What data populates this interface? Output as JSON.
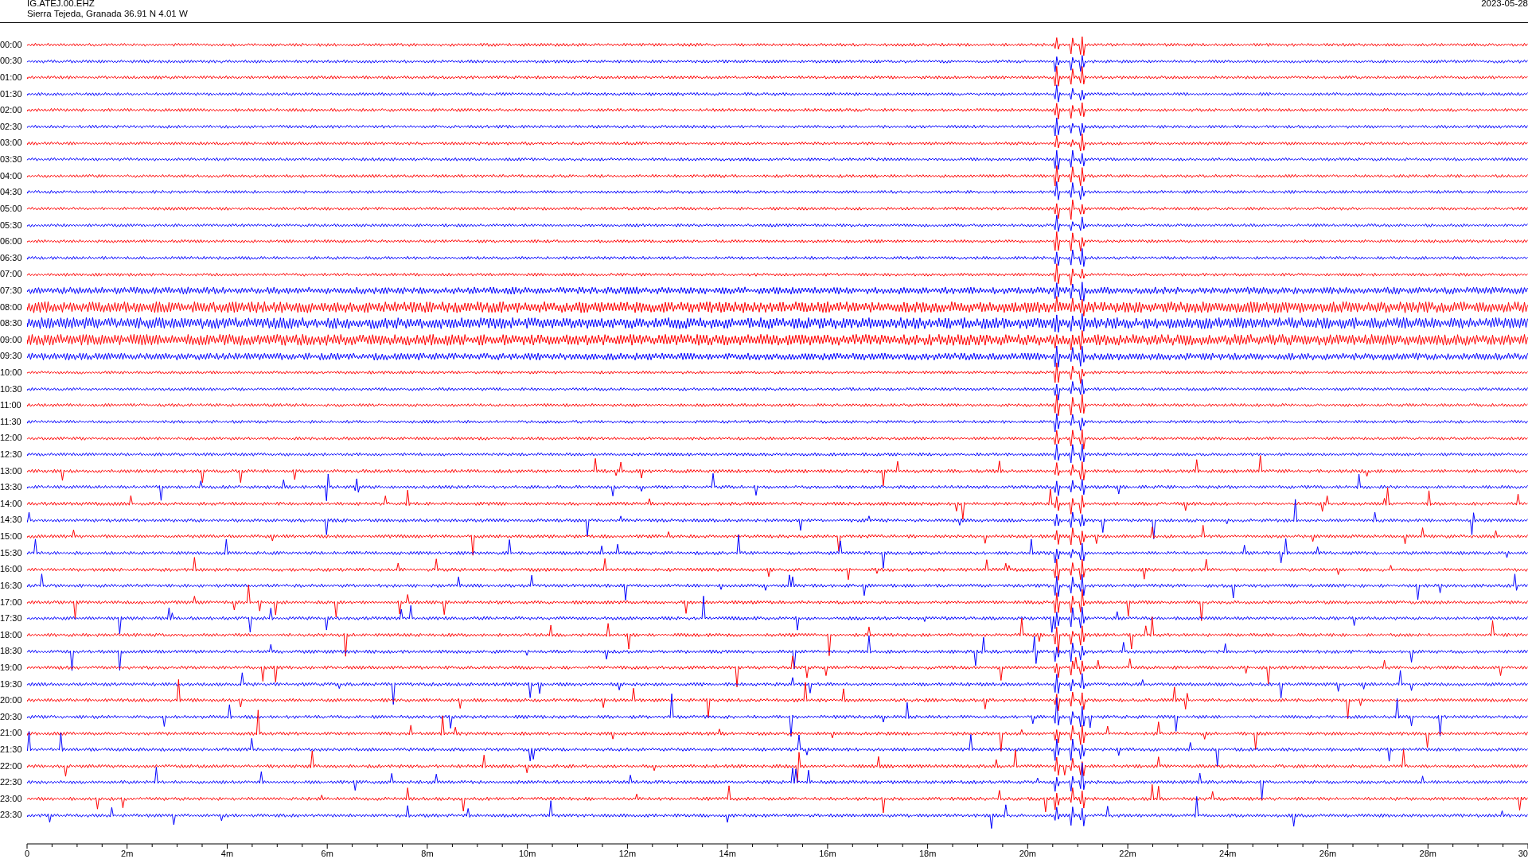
{
  "header": {
    "station": "IG.ATEJ.00.EHZ",
    "location": "Sierra Tejeda, Granada  36.91 N 4.01 W",
    "date": "2023-05-28"
  },
  "rows": [
    {
      "time": "00:00",
      "color": "#ff0000",
      "kind": "quiet"
    },
    {
      "time": "00:30",
      "color": "#0000ff",
      "kind": "quiet"
    },
    {
      "time": "01:00",
      "color": "#ff0000",
      "kind": "quiet"
    },
    {
      "time": "01:30",
      "color": "#0000ff",
      "kind": "quiet"
    },
    {
      "time": "02:00",
      "color": "#ff0000",
      "kind": "quiet"
    },
    {
      "time": "02:30",
      "color": "#0000ff",
      "kind": "quiet"
    },
    {
      "time": "03:00",
      "color": "#ff0000",
      "kind": "quiet"
    },
    {
      "time": "03:30",
      "color": "#0000ff",
      "kind": "quiet"
    },
    {
      "time": "04:00",
      "color": "#ff0000",
      "kind": "quiet"
    },
    {
      "time": "04:30",
      "color": "#0000ff",
      "kind": "quiet"
    },
    {
      "time": "05:00",
      "color": "#ff0000",
      "kind": "quiet"
    },
    {
      "time": "05:30",
      "color": "#0000ff",
      "kind": "quiet"
    },
    {
      "time": "06:00",
      "color": "#ff0000",
      "kind": "quiet"
    },
    {
      "time": "06:30",
      "color": "#0000ff",
      "kind": "quiet"
    },
    {
      "time": "07:00",
      "color": "#ff0000",
      "kind": "quiet"
    },
    {
      "time": "07:30",
      "color": "#0000ff",
      "kind": "noisy"
    },
    {
      "time": "08:00",
      "color": "#ff0000",
      "kind": "loud"
    },
    {
      "time": "08:30",
      "color": "#0000ff",
      "kind": "loud"
    },
    {
      "time": "09:00",
      "color": "#ff0000",
      "kind": "loud"
    },
    {
      "time": "09:30",
      "color": "#0000ff",
      "kind": "noisy"
    },
    {
      "time": "10:00",
      "color": "#ff0000",
      "kind": "quiet"
    },
    {
      "time": "10:30",
      "color": "#0000ff",
      "kind": "quiet"
    },
    {
      "time": "11:00",
      "color": "#ff0000",
      "kind": "quiet"
    },
    {
      "time": "11:30",
      "color": "#0000ff",
      "kind": "quiet"
    },
    {
      "time": "12:00",
      "color": "#ff0000",
      "kind": "quiet"
    },
    {
      "time": "12:30",
      "color": "#0000ff",
      "kind": "quiet"
    },
    {
      "time": "13:00",
      "color": "#ff0000",
      "kind": "spiky"
    },
    {
      "time": "13:30",
      "color": "#0000ff",
      "kind": "spiky"
    },
    {
      "time": "14:00",
      "color": "#ff0000",
      "kind": "spiky"
    },
    {
      "time": "14:30",
      "color": "#0000ff",
      "kind": "spiky"
    },
    {
      "time": "15:00",
      "color": "#ff0000",
      "kind": "spiky"
    },
    {
      "time": "15:30",
      "color": "#0000ff",
      "kind": "spiky"
    },
    {
      "time": "16:00",
      "color": "#ff0000",
      "kind": "spiky"
    },
    {
      "time": "16:30",
      "color": "#0000ff",
      "kind": "spiky"
    },
    {
      "time": "17:00",
      "color": "#ff0000",
      "kind": "spiky"
    },
    {
      "time": "17:30",
      "color": "#0000ff",
      "kind": "spiky"
    },
    {
      "time": "18:00",
      "color": "#ff0000",
      "kind": "spiky"
    },
    {
      "time": "18:30",
      "color": "#0000ff",
      "kind": "spiky"
    },
    {
      "time": "19:00",
      "color": "#ff0000",
      "kind": "spiky"
    },
    {
      "time": "19:30",
      "color": "#0000ff",
      "kind": "spiky"
    },
    {
      "time": "20:00",
      "color": "#ff0000",
      "kind": "spiky"
    },
    {
      "time": "20:30",
      "color": "#0000ff",
      "kind": "spiky"
    },
    {
      "time": "21:00",
      "color": "#ff0000",
      "kind": "spiky"
    },
    {
      "time": "21:30",
      "color": "#0000ff",
      "kind": "spiky"
    },
    {
      "time": "22:00",
      "color": "#ff0000",
      "kind": "spiky"
    },
    {
      "time": "22:30",
      "color": "#0000ff",
      "kind": "spiky"
    },
    {
      "time": "23:00",
      "color": "#ff0000",
      "kind": "spiky"
    },
    {
      "time": "23:30",
      "color": "#0000ff",
      "kind": "spiky"
    }
  ],
  "x_axis": {
    "labels": [
      "0",
      "2m",
      "4m",
      "6m",
      "8m",
      "10m",
      "12m",
      "14m",
      "16m",
      "18m",
      "20m",
      "22m",
      "24m",
      "26m",
      "28m",
      "30"
    ]
  }
}
